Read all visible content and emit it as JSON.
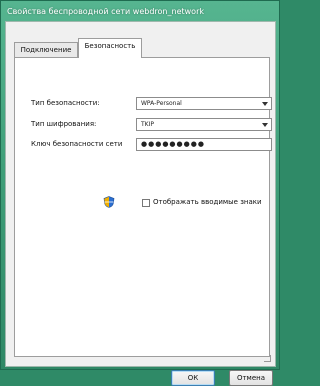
{
  "window": {
    "title": "Свойства беспроводной сети webdron_network"
  },
  "tabs": [
    {
      "label": "Подключение"
    },
    {
      "label": "Безопасность"
    }
  ],
  "security": {
    "security_type_label": "Тип безопасности:",
    "security_type_value": "WPA-Personal",
    "encryption_type_label": "Тип шифрования:",
    "encryption_type_value": "TKIP",
    "network_key_label": "Ключ безопасности сети",
    "network_key_value": "●●●●●●●●●",
    "show_characters_label": "Отображать вводимые знаки"
  },
  "buttons": {
    "ok": "ОК",
    "cancel": "Отмена"
  },
  "colors": {
    "title_bar": "#3f9f79"
  }
}
